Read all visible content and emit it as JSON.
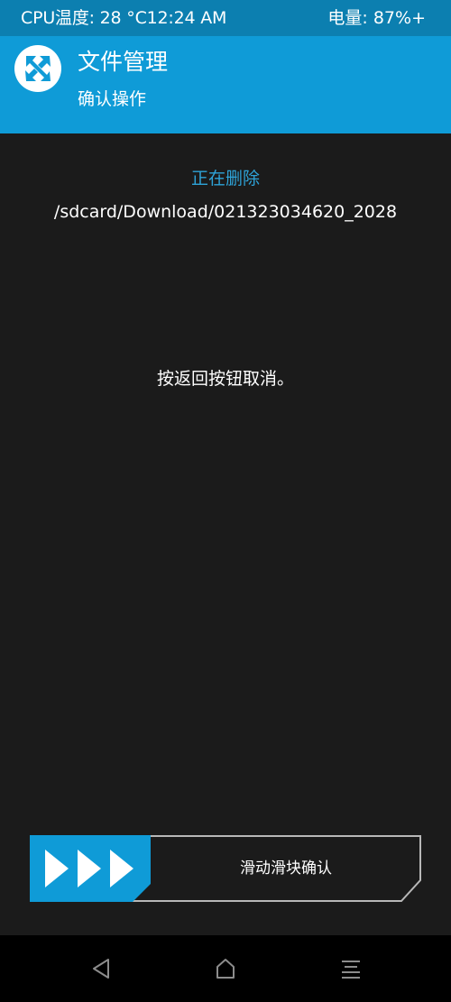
{
  "status_bar": {
    "left_text": "CPU温度: 28 °C12:24 AM",
    "battery_text": "电量: 87%+"
  },
  "header": {
    "logo_icon": "twrp-logo-icon",
    "title": "文件管理",
    "subtitle": "确认操作"
  },
  "content": {
    "action_label": "正在删除",
    "file_path": "/sdcard/Download/021323034620_2028",
    "cancel_hint": "按返回按钮取消。"
  },
  "slider": {
    "label": "滑动滑块确认",
    "handle_icon": "triple-chevron-right-icon"
  },
  "nav_bar": {
    "back_icon": "back-triangle-icon",
    "home_icon": "home-icon",
    "menu_icon": "menu-lines-icon"
  },
  "colors": {
    "header_blue": "#0f9bd7",
    "status_blue": "#0c7fb0",
    "accent_text": "#2ea3d8",
    "background": "#1b1b1b"
  }
}
